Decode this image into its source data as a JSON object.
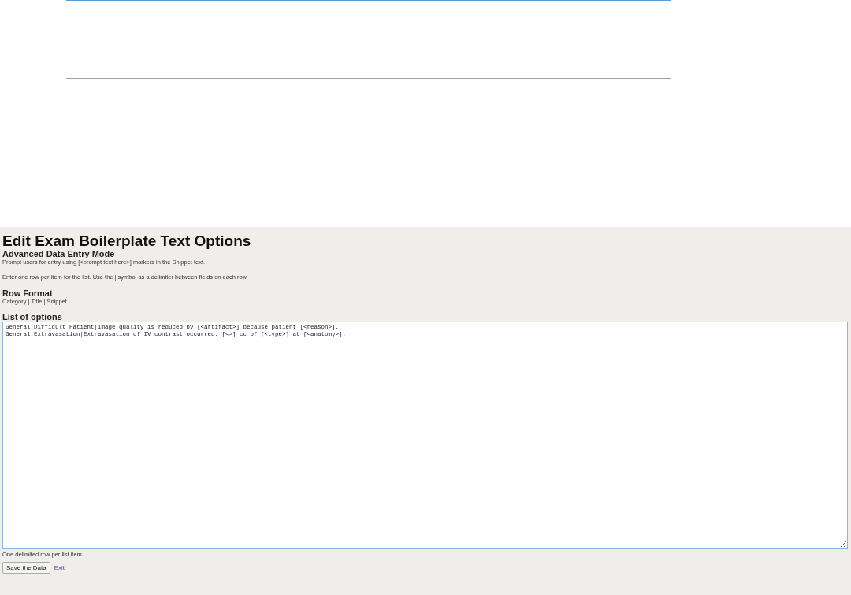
{
  "page": {
    "title": "Edit Exam Boilerplate Text Options",
    "subtitle": "Advanced Data Entry Mode",
    "prompt_hint": "Prompt users for entry using [<prompt text here>] markers in the Snippet text.",
    "instructions": "Enter one row per item for the list. Use the | symbol as a delimiter between fields on each row.",
    "row_format_heading": "Row Format",
    "row_format": "Category | Title | Snippet",
    "list_heading": "List of options",
    "list_value": "General|Difficult Patient|Image quality is reduced by [<artifact>] because patient [<reason>].\nGeneral|Extravasation|Extravasation of IV contrast occurred. [<>] cc of [<type>] at [<anatomy>].",
    "list_hint": "One delimited row per list item.",
    "save_button": "Save the Data",
    "exit_link": "Exit"
  }
}
